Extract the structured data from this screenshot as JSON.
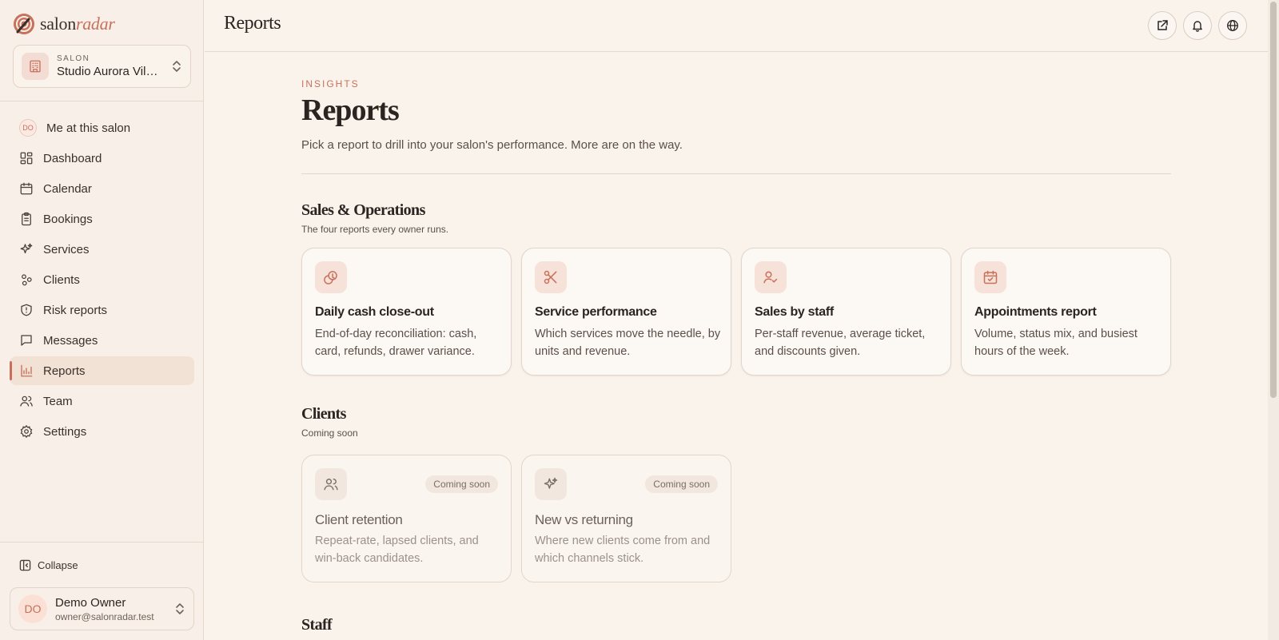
{
  "brand": {
    "name_part1": "salon",
    "name_part2": "radar"
  },
  "salon_switcher": {
    "label": "SALON",
    "name": "Studio Aurora Vilnius"
  },
  "sidebar": {
    "me_badge": "DO",
    "items": [
      {
        "label": "Me at this salon",
        "icon": "me-avatar-icon"
      },
      {
        "label": "Dashboard",
        "icon": "grid-icon"
      },
      {
        "label": "Calendar",
        "icon": "calendar-icon"
      },
      {
        "label": "Bookings",
        "icon": "clipboard-icon"
      },
      {
        "label": "Services",
        "icon": "sparkles-icon"
      },
      {
        "label": "Clients",
        "icon": "clients-icon"
      },
      {
        "label": "Risk reports",
        "icon": "shield-icon"
      },
      {
        "label": "Messages",
        "icon": "message-icon"
      },
      {
        "label": "Reports",
        "icon": "bar-chart-icon",
        "active": true
      },
      {
        "label": "Team",
        "icon": "users-icon"
      },
      {
        "label": "Settings",
        "icon": "gear-icon"
      }
    ],
    "collapse_label": "Collapse"
  },
  "user": {
    "initials": "DO",
    "name": "Demo Owner",
    "email": "owner@salonradar.test"
  },
  "topbar": {
    "title": "Reports"
  },
  "page": {
    "eyebrow": "INSIGHTS",
    "title": "Reports",
    "subtitle": "Pick a report to drill into your salon's performance. More are on the way."
  },
  "sections": [
    {
      "title": "Sales & Operations",
      "subtitle": "The four reports every owner runs.",
      "cards": [
        {
          "title": "Daily cash close-out",
          "desc": "End-of-day reconciliation: cash, card, refunds, drawer variance.",
          "icon": "coins-icon"
        },
        {
          "title": "Service performance",
          "desc": "Which services move the needle, by units and revenue.",
          "icon": "scissors-icon"
        },
        {
          "title": "Sales by staff",
          "desc": "Per-staff revenue, average ticket, and discounts given.",
          "icon": "user-check-icon"
        },
        {
          "title": "Appointments report",
          "desc": "Volume, status mix, and busiest hours of the week.",
          "icon": "calendar-check-icon"
        }
      ]
    },
    {
      "title": "Clients",
      "subtitle": "Coming soon",
      "cards": [
        {
          "title": "Client retention",
          "desc": "Repeat-rate, lapsed clients, and win-back candidates.",
          "icon": "users-icon",
          "badge": "Coming soon"
        },
        {
          "title": "New vs returning",
          "desc": "Where new clients come from and which channels stick.",
          "icon": "sparkles-icon",
          "badge": "Coming soon"
        }
      ]
    },
    {
      "title": "Staff"
    }
  ],
  "colors": {
    "accent": "#c8705a",
    "background": "#faf3ec",
    "text": "#2b2421"
  }
}
